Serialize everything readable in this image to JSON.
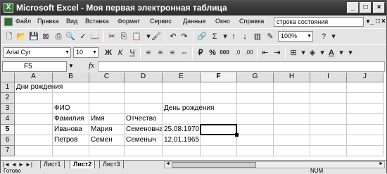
{
  "window": {
    "title": "Microsoft Excel - Моя первая электронная таблица",
    "minimize": "_",
    "maximize": "□",
    "close": "×"
  },
  "menubar": {
    "items": [
      "Файл",
      "Правка",
      "Вид",
      "Вставка",
      "Формат",
      "Сервис",
      "Данные",
      "Окно",
      "Справка"
    ],
    "help_box": "строка состояния",
    "doc_buttons": [
      "_",
      "□",
      "×"
    ]
  },
  "toolbar_standard": {
    "zoom": "100%",
    "help": "?"
  },
  "toolbar_format": {
    "font_name": "Arial Cyr",
    "font_size": "10",
    "bold": "Ж",
    "italic": "К",
    "underline": "Ч",
    "percent": "%",
    "thousands": "000",
    "currency": "₽"
  },
  "formula_bar": {
    "name_box": "F5",
    "fx": "fx",
    "value": ""
  },
  "grid": {
    "columns": [
      "A",
      "B",
      "C",
      "D",
      "E",
      "F",
      "G",
      "H",
      "I",
      "J"
    ],
    "rows": [
      "1",
      "2",
      "3",
      "4",
      "5",
      "6",
      "7"
    ],
    "cells": {
      "A1": "Дни рождения",
      "B3": "ФИО",
      "E3": "День рождения",
      "B4": "Фамилия",
      "C4": "Имя",
      "D4": "Отчество",
      "B5": "Иванова",
      "C5": "Мария",
      "D5": "Семеновна",
      "E5": "25.08.1970",
      "B6": "Петров",
      "C6": "Семен",
      "D6": "Семеныч",
      "E6": "12.01.1965"
    },
    "active_cell": "F5"
  },
  "sheets": {
    "tabs": [
      "Лист1",
      "Лист2",
      "Лист3"
    ],
    "active": "Лист2"
  },
  "statusbar": {
    "text": "Готово",
    "num": "NUM"
  }
}
